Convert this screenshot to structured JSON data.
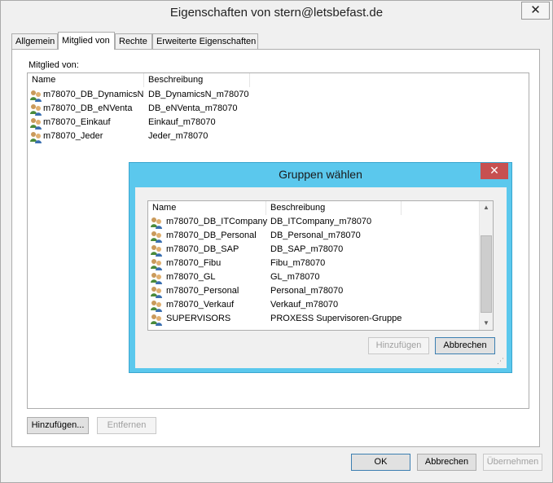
{
  "window": {
    "title": "Eigenschaften von stern@letsbefast.de",
    "close_label": "✕"
  },
  "tabs": [
    {
      "label": "Allgemein"
    },
    {
      "label": "Mitglied von"
    },
    {
      "label": "Rechte"
    },
    {
      "label": "Erweiterte Eigenschaften"
    }
  ],
  "member_list": {
    "label": "Mitglied von:",
    "columns": [
      "Name",
      "Beschreibung"
    ],
    "rows": [
      {
        "name": "m78070_DB_DynamicsN",
        "description": "DB_DynamicsN_m78070"
      },
      {
        "name": "m78070_DB_eNVenta",
        "description": "DB_eNVenta_m78070"
      },
      {
        "name": "m78070_Einkauf",
        "description": "Einkauf_m78070"
      },
      {
        "name": "m78070_Jeder",
        "description": "Jeder_m78070"
      }
    ]
  },
  "panel_buttons": {
    "add": "Hinzufügen...",
    "remove": "Entfernen"
  },
  "dialog_buttons": {
    "ok": "OK",
    "cancel": "Abbrechen",
    "apply": "Übernehmen"
  },
  "group_dialog": {
    "title": "Gruppen wählen",
    "close_label": "✕",
    "columns": [
      "Name",
      "Beschreibung"
    ],
    "rows": [
      {
        "name": "m78070_DB_ITCompany",
        "description": "DB_ITCompany_m78070"
      },
      {
        "name": "m78070_DB_Personal",
        "description": "DB_Personal_m78070"
      },
      {
        "name": "m78070_DB_SAP",
        "description": "DB_SAP_m78070"
      },
      {
        "name": "m78070_Fibu",
        "description": "Fibu_m78070"
      },
      {
        "name": "m78070_GL",
        "description": "GL_m78070"
      },
      {
        "name": "m78070_Personal",
        "description": "Personal_m78070"
      },
      {
        "name": "m78070_Verkauf",
        "description": "Verkauf_m78070"
      },
      {
        "name": "SUPERVISORS",
        "description": "PROXESS Supervisoren-Gruppe"
      }
    ],
    "add_button": "Hinzufügen",
    "cancel_button": "Abbrechen"
  },
  "icons": {
    "group": "group-icon",
    "scroll_up": "scroll-up-arrow-icon",
    "scroll_down": "scroll-down-arrow-icon",
    "resize_grip": "resize-grip-icon"
  },
  "colors": {
    "dialog_titlebar": "#5bc8ed",
    "close_button": "#c75050"
  }
}
